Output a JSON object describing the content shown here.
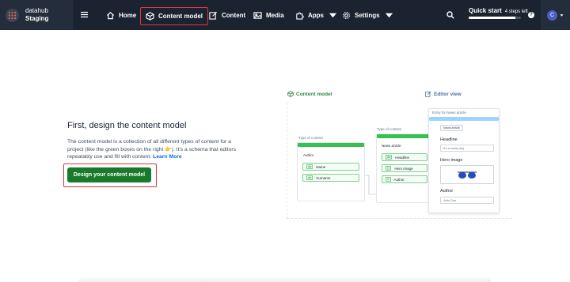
{
  "space": {
    "org_name": "datahub",
    "env_name": "Staging"
  },
  "nav": {
    "home": "Home",
    "content_model": "Content model",
    "content": "Content",
    "media": "Media",
    "apps": "Apps",
    "settings": "Settings"
  },
  "quick_start": {
    "title": "Quick start",
    "steps_left": "4 steps left",
    "progress": 0.9
  },
  "help": {
    "label": "?"
  },
  "account": {
    "initial": "C"
  },
  "main": {
    "title": "First, design the content model",
    "description": "The content model is a collection of all different types of content for a project (like the green boxes on the right 👉). It's a schema that editors repeatably use and fill with content. ",
    "learn_more": "Learn More",
    "cta": "Design your content model"
  },
  "illustration": {
    "content_model_heading": "Content model",
    "editor_view_heading": "Editor view",
    "type1": {
      "caption": "Type of content",
      "name": "Author",
      "fields": [
        {
          "badge": "Aa",
          "label": "Name"
        },
        {
          "badge": "Aa",
          "label": "Surname"
        }
      ]
    },
    "type2": {
      "caption": "Type of content",
      "name": "News article",
      "fields": [
        {
          "badge": "Aa",
          "label": "Headline"
        },
        {
          "badge": "▢",
          "label": "Hero image"
        },
        {
          "badge": "∞",
          "label": "Author"
        }
      ]
    },
    "editor": {
      "caption": "Entry for News article",
      "tag": "News article",
      "headline_label": "Headline",
      "headline_value": "It's a sunny day",
      "image_label": "Hero image",
      "author_label": "Author",
      "author_value": "John Doe"
    }
  },
  "colors": {
    "nav_bg": "#1b2330",
    "highlight": "#e0353d",
    "cta_bg": "#1a7a2c",
    "link": "#036fe3",
    "model_green": "#36c052",
    "editor_blue": "#9fd3ff"
  }
}
